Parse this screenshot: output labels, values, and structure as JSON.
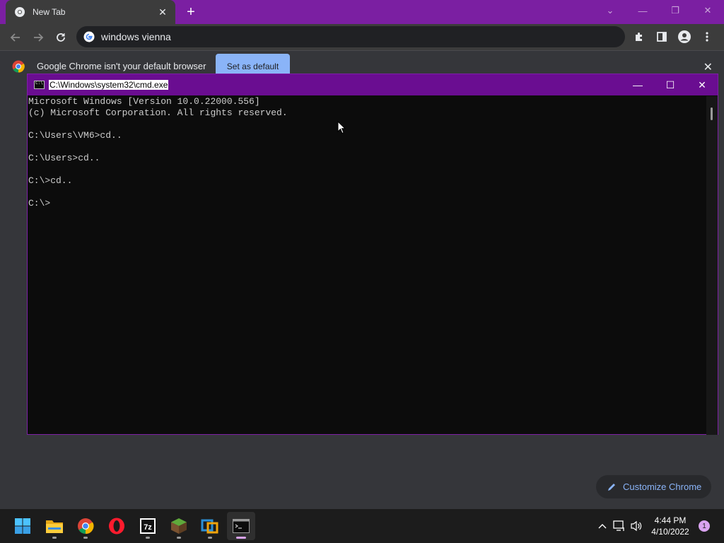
{
  "browser": {
    "tab": {
      "title": "New Tab",
      "close_glyph": "✕",
      "icon": "chrome-favicon"
    },
    "new_tab_glyph": "+",
    "window_controls": {
      "tab_search": "⌄",
      "minimize": "—",
      "restore": "❐",
      "close": "✕"
    },
    "omnibox": {
      "url": "windows vienna",
      "icon": "google-g-icon"
    },
    "toolbar_icons": [
      "back-icon",
      "forward-icon",
      "reload-icon",
      "extensions-icon",
      "side-panel-icon",
      "profile-icon",
      "menu-icon"
    ]
  },
  "infobar": {
    "message": "Google Chrome isn't your default browser",
    "button": "Set as default",
    "close_glyph": "✕"
  },
  "ntp": {
    "customize_label": "Customize Chrome"
  },
  "cmd": {
    "title": "C:\\Windows\\system32\\cmd.exe",
    "controls": {
      "minimize": "—",
      "maximize": "☐",
      "close": "✕"
    },
    "lines": [
      "Microsoft Windows [Version 10.0.22000.556]",
      "(c) Microsoft Corporation. All rights reserved.",
      "",
      "C:\\Users\\VM6>cd..",
      "",
      "C:\\Users>cd..",
      "",
      "C:\\>cd..",
      "",
      "C:\\>"
    ]
  },
  "taskbar": {
    "apps": [
      "start-icon",
      "file-explorer-icon",
      "chrome-icon",
      "opera-icon",
      "7zip-icon",
      "minecraft-icon",
      "virtualbox-icon",
      "cmd-icon"
    ],
    "time": "4:44 PM",
    "date": "4/10/2022",
    "notification_count": "1"
  },
  "colors": {
    "accent_purple": "#7b1fa2",
    "cmd_title": "#6a0d91",
    "link_blue": "#8ab4f8"
  }
}
